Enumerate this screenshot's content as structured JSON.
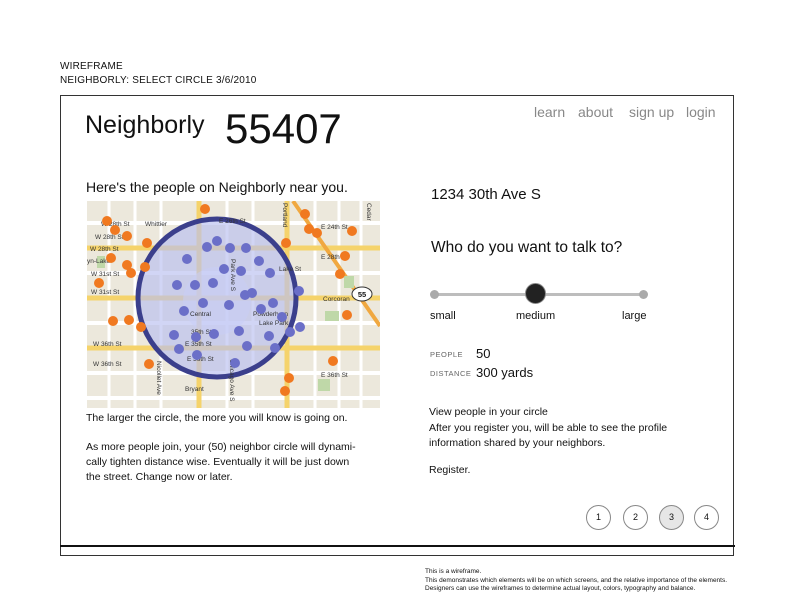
{
  "doc_header": {
    "line1": "WIREFRAME",
    "line2": "NEIGHBORLY: SELECT CIRCLE  3/6/2010"
  },
  "site": {
    "brand": "Neighborly",
    "zip": "55407"
  },
  "nav": [
    {
      "label": "learn"
    },
    {
      "label": "about"
    },
    {
      "label": "sign up"
    },
    {
      "label": "login"
    }
  ],
  "intro": "Here's the people on Neighborly near you.",
  "map": {
    "streets": [
      "W 28th St",
      "Whittier",
      "E 26th St",
      "W 28th St",
      "W 28th St",
      "yn-Lake",
      "W 31st St",
      "W 31st St",
      "W 36th St",
      "W 36th St",
      "Central",
      "35th St",
      "E 35th St",
      "E 36th St",
      "Powderhorn",
      "Lake Park",
      "Corcoran",
      "E 36th St",
      "Bryant",
      "Chicago Ave S",
      "Park Ave S",
      "Nicollet Ave",
      "Lake St",
      "E 28th St",
      "E 24th St",
      "Portland",
      "Cedar"
    ],
    "highway_label": "55",
    "accent": "#3b3f8c",
    "orange": "#f07920"
  },
  "caption_1": "The larger the circle, the  more you will know is going on.",
  "caption_2": [
    "As more people join, your (50) neighbor circle will dynami-",
    "cally tighten distance wise. Eventually it will be just down",
    "the street. Change now or later."
  ],
  "address": "1234 30th Ave S",
  "question": "Who do you want to talk to?",
  "slider": {
    "options": [
      "small",
      "medium",
      "large"
    ],
    "selected": "medium",
    "selected_index": 1
  },
  "stats": {
    "people_label": "PEOPLE",
    "people_value": "50",
    "distance_label": "DISTANCE",
    "distance_value": "300 yards"
  },
  "view": {
    "title": "View people in your circle",
    "body_1": "After you register you, will be able to see the profile",
    "body_2": "information shared by your neighbors.",
    "register": "Register."
  },
  "pages": [
    "1",
    "2",
    "3",
    "4"
  ],
  "active_page": "3",
  "footer": {
    "line1": "This is a wireframe.",
    "line2": "This demonstrates which elements will be on which screens, and the relative importance of the elements.",
    "line3": "Designers can use the wireframes to determine actual layout, colors, typography and balance."
  }
}
